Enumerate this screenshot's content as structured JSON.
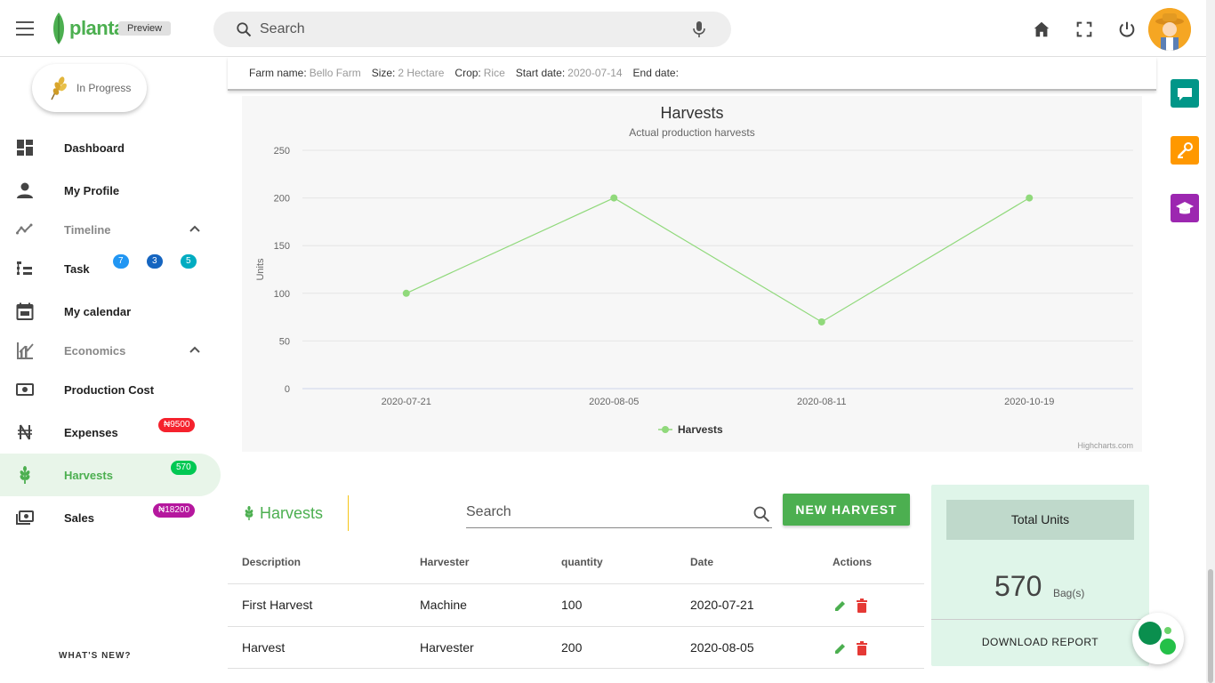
{
  "header": {
    "logo_text": "planta",
    "preview_label": "Preview",
    "search_placeholder": "Search",
    "icons": [
      "menu-icon",
      "mic-icon",
      "home-icon",
      "fullscreen-icon",
      "power-icon"
    ]
  },
  "sidebar": {
    "status": "In Progress",
    "items": [
      {
        "label": "Dashboard",
        "icon": "dashboard-icon"
      },
      {
        "label": "My Profile",
        "icon": "person-icon"
      },
      {
        "label": "Timeline",
        "icon": "timeline-icon"
      },
      {
        "label": "Task",
        "icon": "task-icon"
      },
      {
        "label": "My calendar",
        "icon": "calendar-icon"
      },
      {
        "label": "Economics",
        "icon": "economics-icon"
      },
      {
        "label": "Production Cost",
        "icon": "money-icon"
      },
      {
        "label": "Expenses",
        "icon": "naira-icon"
      },
      {
        "label": "Harvests",
        "icon": "wheat-icon"
      },
      {
        "label": "Sales",
        "icon": "cash-icon"
      }
    ],
    "task_badges": [
      "7",
      "3",
      "5"
    ],
    "expenses_badge": "₦9500",
    "harvests_badge": "570",
    "sales_badge": "₦18200",
    "whats_new": "WHAT'S NEW?"
  },
  "info": {
    "farm_name_label": "Farm name:",
    "farm_name": "Bello Farm",
    "size_label": "Size:",
    "size": "2 Hectare",
    "crop_label": "Crop:",
    "crop": "Rice",
    "start_label": "Start date:",
    "start": "2020-07-14",
    "end_label": "End date:",
    "end": ""
  },
  "chart_data": {
    "type": "line",
    "title": "Harvests",
    "subtitle": "Actual production harvests",
    "ylabel": "Units",
    "xlabel": "",
    "categories": [
      "2020-07-21",
      "2020-08-05",
      "2020-08-11",
      "2020-10-19"
    ],
    "series": [
      {
        "name": "Harvests",
        "values": [
          100,
          200,
          70,
          200
        ]
      }
    ],
    "ylim": [
      0,
      250
    ],
    "yticks": [
      0,
      50,
      100,
      150,
      200,
      250
    ],
    "grid": true,
    "legend": "bottom-center",
    "credits": "Highcharts.com",
    "color": "#90d97b"
  },
  "table": {
    "title": "Harvests",
    "search_placeholder": "Search",
    "new_button": "NEW HARVEST",
    "columns": [
      "Description",
      "Harvester",
      "quantity",
      "Date",
      "Actions"
    ],
    "rows": [
      {
        "description": "First Harvest",
        "harvester": "Machine",
        "quantity": "100",
        "date": "2020-07-21"
      },
      {
        "description": "Harvest",
        "harvester": "Harvester",
        "quantity": "200",
        "date": "2020-08-05"
      }
    ]
  },
  "total": {
    "title": "Total Units",
    "value": "570",
    "unit": "Bag(s)",
    "download": "DOWNLOAD REPORT"
  },
  "colors": {
    "brand": "#4caf50",
    "side_teal": "#009688",
    "side_orange": "#ff9800",
    "side_purple": "#9c27b0"
  }
}
